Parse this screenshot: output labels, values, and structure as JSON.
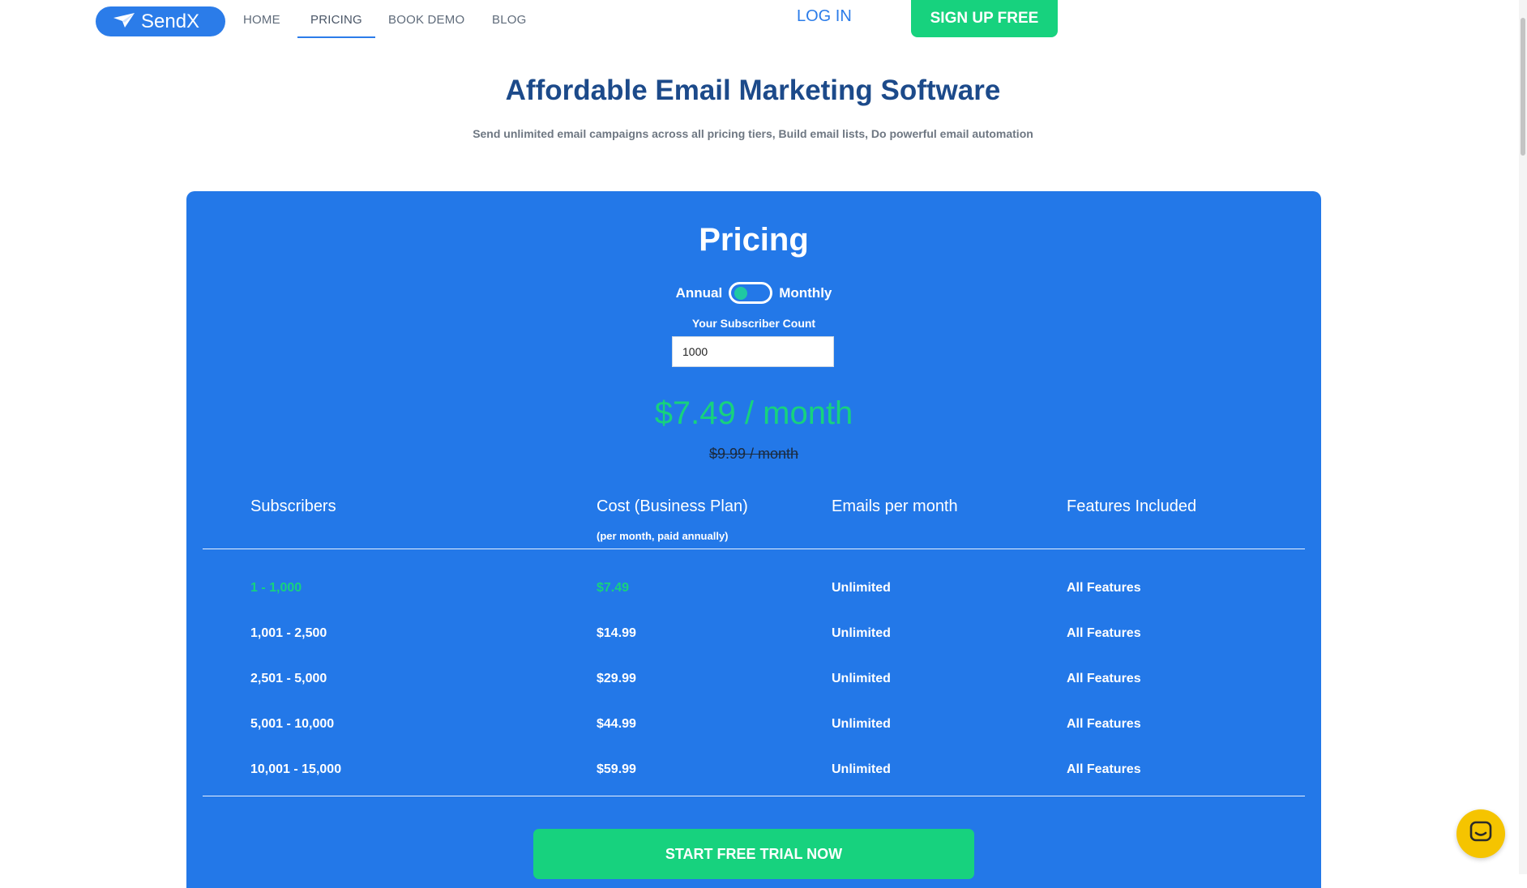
{
  "header": {
    "logo_text": "SendX",
    "nav": [
      {
        "label": "HOME"
      },
      {
        "label": "PRICING"
      },
      {
        "label": "BOOK DEMO"
      },
      {
        "label": "BLOG"
      }
    ],
    "login_label": "LOG IN",
    "signup_label": "SIGN UP FREE"
  },
  "hero": {
    "title": "Affordable Email Marketing Software",
    "subtitle": "Send unlimited email campaigns across all pricing tiers, Build email lists, Do powerful email automation"
  },
  "pricing": {
    "title": "Pricing",
    "toggle": {
      "left_label": "Annual",
      "right_label": "Monthly"
    },
    "subscriber_label": "Your Subscriber Count",
    "subscriber_value": "1000",
    "price": "$7.49 / month",
    "old_price": "$9.99 / month",
    "columns": {
      "subscribers": "Subscribers",
      "cost": "Cost (Business Plan)",
      "cost_note": "(per month, paid annually)",
      "emails": "Emails per month",
      "features": "Features Included"
    },
    "rows": [
      {
        "subscribers": "1 - 1,000",
        "cost": "$7.49",
        "emails": "Unlimited",
        "features": "All Features"
      },
      {
        "subscribers": "1,001 - 2,500",
        "cost": "$14.99",
        "emails": "Unlimited",
        "features": "All Features"
      },
      {
        "subscribers": "2,501 - 5,000",
        "cost": "$29.99",
        "emails": "Unlimited",
        "features": "All Features"
      },
      {
        "subscribers": "5,001 - 10,000",
        "cost": "$44.99",
        "emails": "Unlimited",
        "features": "All Features"
      },
      {
        "subscribers": "10,001 - 15,000",
        "cost": "$59.99",
        "emails": "Unlimited",
        "features": "All Features"
      }
    ],
    "cta_label": "START FREE TRIAL NOW"
  },
  "colors": {
    "brand_blue": "#2378e8",
    "accent_green": "#17d27e",
    "heading_navy": "#1c4a8a",
    "chat_yellow": "#f5c400"
  },
  "icons": {
    "logo": "paper-plane-icon",
    "chat": "chat-bubble-icon"
  }
}
